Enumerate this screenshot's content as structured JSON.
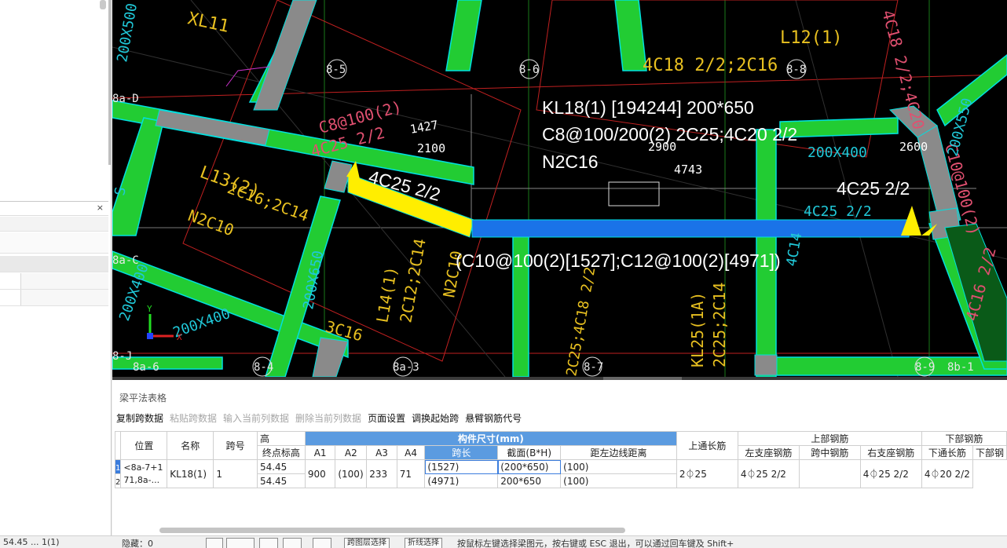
{
  "canvas": {
    "axis_labels": [
      "8-5",
      "8-6",
      "8-8",
      "8a-D",
      "8a-C",
      "8-J",
      "8a-6",
      "8-4",
      "8a-3",
      "8-7",
      "8-9",
      "8b-1"
    ],
    "beam_labels": {
      "xl11": "XL11",
      "l12": "L12(1)",
      "l13": "L13(2)",
      "l14": "L14(1)",
      "kl25": "KL25(1A)",
      "rebar_4c18": "4C18 2/2;2C16",
      "rebar_4c18_right": "4C18 2/2;4C20",
      "c8_left": "C8@100(2)",
      "c8_right": "C10@100(2)",
      "l13_bottom": "2C16;2C14",
      "n2c10": "N2C10",
      "l14_rebar": "2C12;2C14",
      "n2c10_b": "N2C10",
      "kl25_rebar": "2C25;2C14",
      "c16": "3C16",
      "size_200x400": "200X400",
      "size_200x400_b": "200X400",
      "size_200x400_c": "200X400",
      "size_200x500": "200X500",
      "size_200x550": "200X550",
      "size_200x650": "200X650",
      "left_4c25": "4C25 2/2",
      "right_4c25": "4C25 2/2",
      "right_4c25_b": "4C25 2/2",
      "mid_vert": "2C25;4C18 2/2",
      "mid_vert2": "4C16 2/2",
      "s": "S",
      "c14": "4C14"
    },
    "dims": {
      "d1427": "1427",
      "d2100": "2100",
      "d2900": "2900",
      "d4743": "4743",
      "d2600": "2600"
    },
    "annot": {
      "line1": "KL18(1) [194244] 200*650",
      "line2": "C8@100/200(2) 2C25;4C20 2/2",
      "line3": "N2C16",
      "left_seat": "4C25 2/2",
      "right_seat": "4C25 2/2",
      "hanger": "(C10@100(2)[1527];C12@100(2)[4971])"
    },
    "ucs": {
      "y": "Y",
      "x": "X"
    }
  },
  "table_panel": {
    "title": "梁平法表格",
    "toolbar": [
      {
        "label": "复制跨数据",
        "enabled": true
      },
      {
        "label": "粘贴跨数据",
        "enabled": false
      },
      {
        "label": "输入当前列数据",
        "enabled": false
      },
      {
        "label": "删除当前列数据",
        "enabled": false
      },
      {
        "label": "页面设置",
        "enabled": true
      },
      {
        "label": "调换起始跨",
        "enabled": true
      },
      {
        "label": "悬臂钢筋代号",
        "enabled": true
      }
    ],
    "headers": {
      "position": "位置",
      "name": "名称",
      "span_no": "跨号",
      "height": "高",
      "end_elev": "终点标高",
      "group_size": "构件尺寸(mm)",
      "a1": "A1",
      "a2": "A2",
      "a3": "A3",
      "a4": "A4",
      "span_len": "跨长",
      "section": "截面(B*H)",
      "edge_dist": "距左边线距离",
      "top_long": "上通长筋",
      "group_top": "上部钢筋",
      "left_seat": "左支座钢筋",
      "mid_span": "跨中钢筋",
      "right_seat": "右支座钢筋",
      "group_bottom": "下部钢筋",
      "bot_long": "下通长筋",
      "bottom": "下部钢"
    },
    "rows": [
      {
        "no": "1",
        "position": "<8a-7+1 71,8a-...",
        "name": "KL18(1)",
        "span": "1",
        "elev": "54.45",
        "a1": "900",
        "a2": "(100)",
        "a3": "233",
        "a4": "71",
        "span_len": "(1527)",
        "section": "(200*650)",
        "edge": "(100)",
        "top_long": "2⏀25",
        "left_seat": "4⏀25 2/2",
        "mid": "",
        "right_seat": "4⏀25 2/2",
        "bot_long": "4⏀20 2/2",
        "bottom": ""
      },
      {
        "no": "2",
        "elev": "54.45",
        "span_len": "(4971)",
        "section": "200*650",
        "edge": "(100)"
      }
    ]
  },
  "status": {
    "left": "54.45 ... 1(1)",
    "mid": "隐藏：0",
    "btn1": "跨图层选择",
    "btn2": "折线选择",
    "hint": "按鼠标左键选择梁图元，按右键或 ESC 退出，可以通过回车键及 Shift+"
  }
}
